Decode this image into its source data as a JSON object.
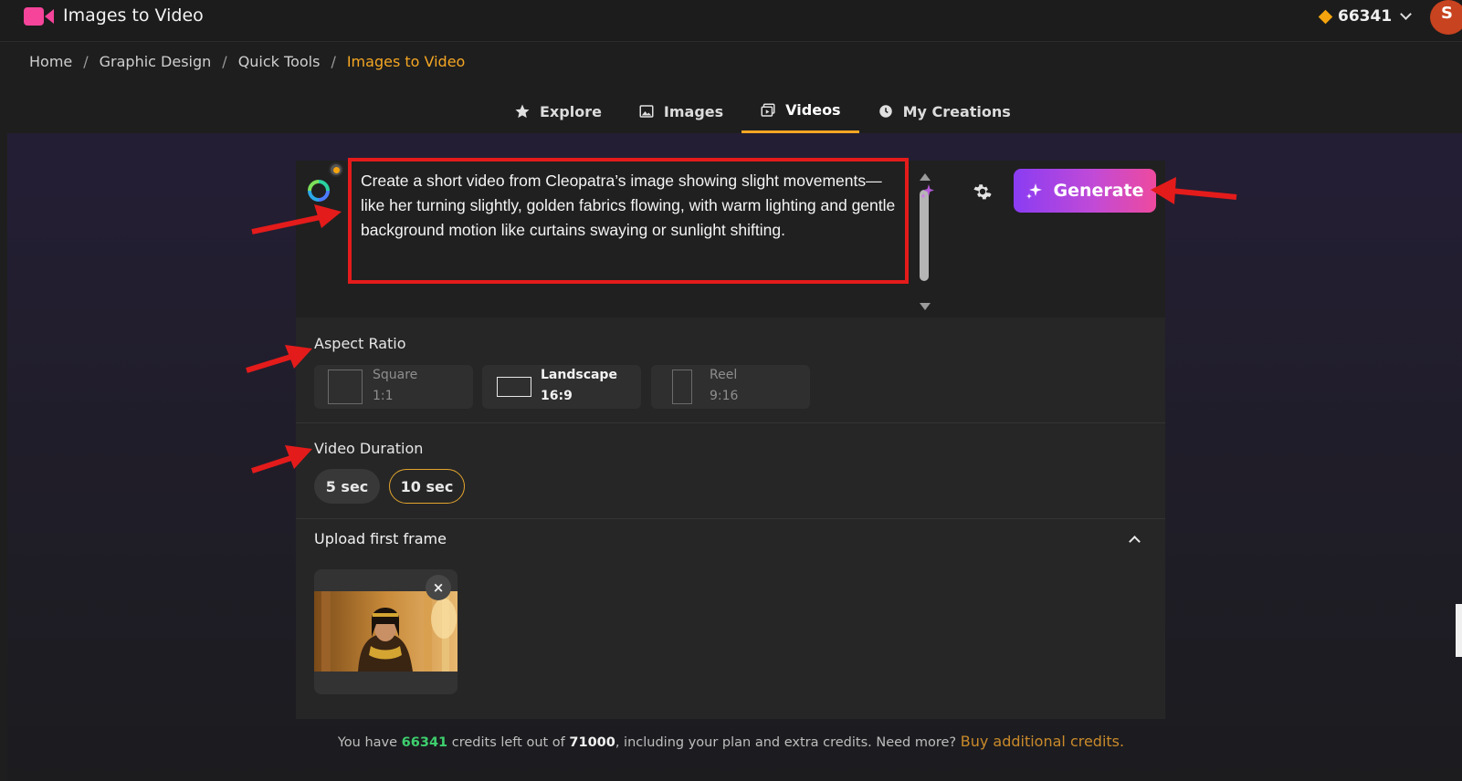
{
  "app": {
    "title": "Images to Video",
    "logo_icon": "video-camera-icon",
    "accent": "#f5449a"
  },
  "account": {
    "credits": "66341",
    "avatar_letter": "S"
  },
  "breadcrumb": {
    "items": [
      "Home",
      "Graphic Design",
      "Quick Tools"
    ],
    "current": "Images to Video",
    "separator": "/"
  },
  "tabs": [
    {
      "label": "Explore",
      "icon": "star-icon",
      "active": false
    },
    {
      "label": "Images",
      "icon": "image-icon",
      "active": false
    },
    {
      "label": "Videos",
      "icon": "videos-icon",
      "active": true
    },
    {
      "label": "My Creations",
      "icon": "clock-icon",
      "active": false
    }
  ],
  "prompt": {
    "text": "Create a short video from Cleopatra’s image showing slight movements—like her turning slightly, golden fabrics flowing, with warm lighting and gentle background motion like curtains swaying or sunlight shifting."
  },
  "generate": {
    "label": "Generate",
    "colors": [
      "#8a3cf2",
      "#ee4a9e"
    ]
  },
  "aspect_ratio": {
    "label": "Aspect Ratio",
    "options": [
      {
        "name": "Square",
        "value": "1:1",
        "active": false
      },
      {
        "name": "Landscape",
        "value": "16:9",
        "active": true
      },
      {
        "name": "Reel",
        "value": "9:16",
        "active": false
      }
    ]
  },
  "duration": {
    "label": "Video Duration",
    "options": [
      {
        "label": "5 sec",
        "active": false
      },
      {
        "label": "10 sec",
        "active": true
      }
    ]
  },
  "upload": {
    "title": "Upload first frame",
    "close_label": "×"
  },
  "footer": {
    "prefix": "You have",
    "credits_left": "66341",
    "middle": "credits left out of",
    "credits_total": "71000",
    "suffix": ", including your plan and extra credits. Need more?",
    "link": "Buy additional credits."
  },
  "annotations": {
    "arrow_color": "#e41b1b"
  }
}
